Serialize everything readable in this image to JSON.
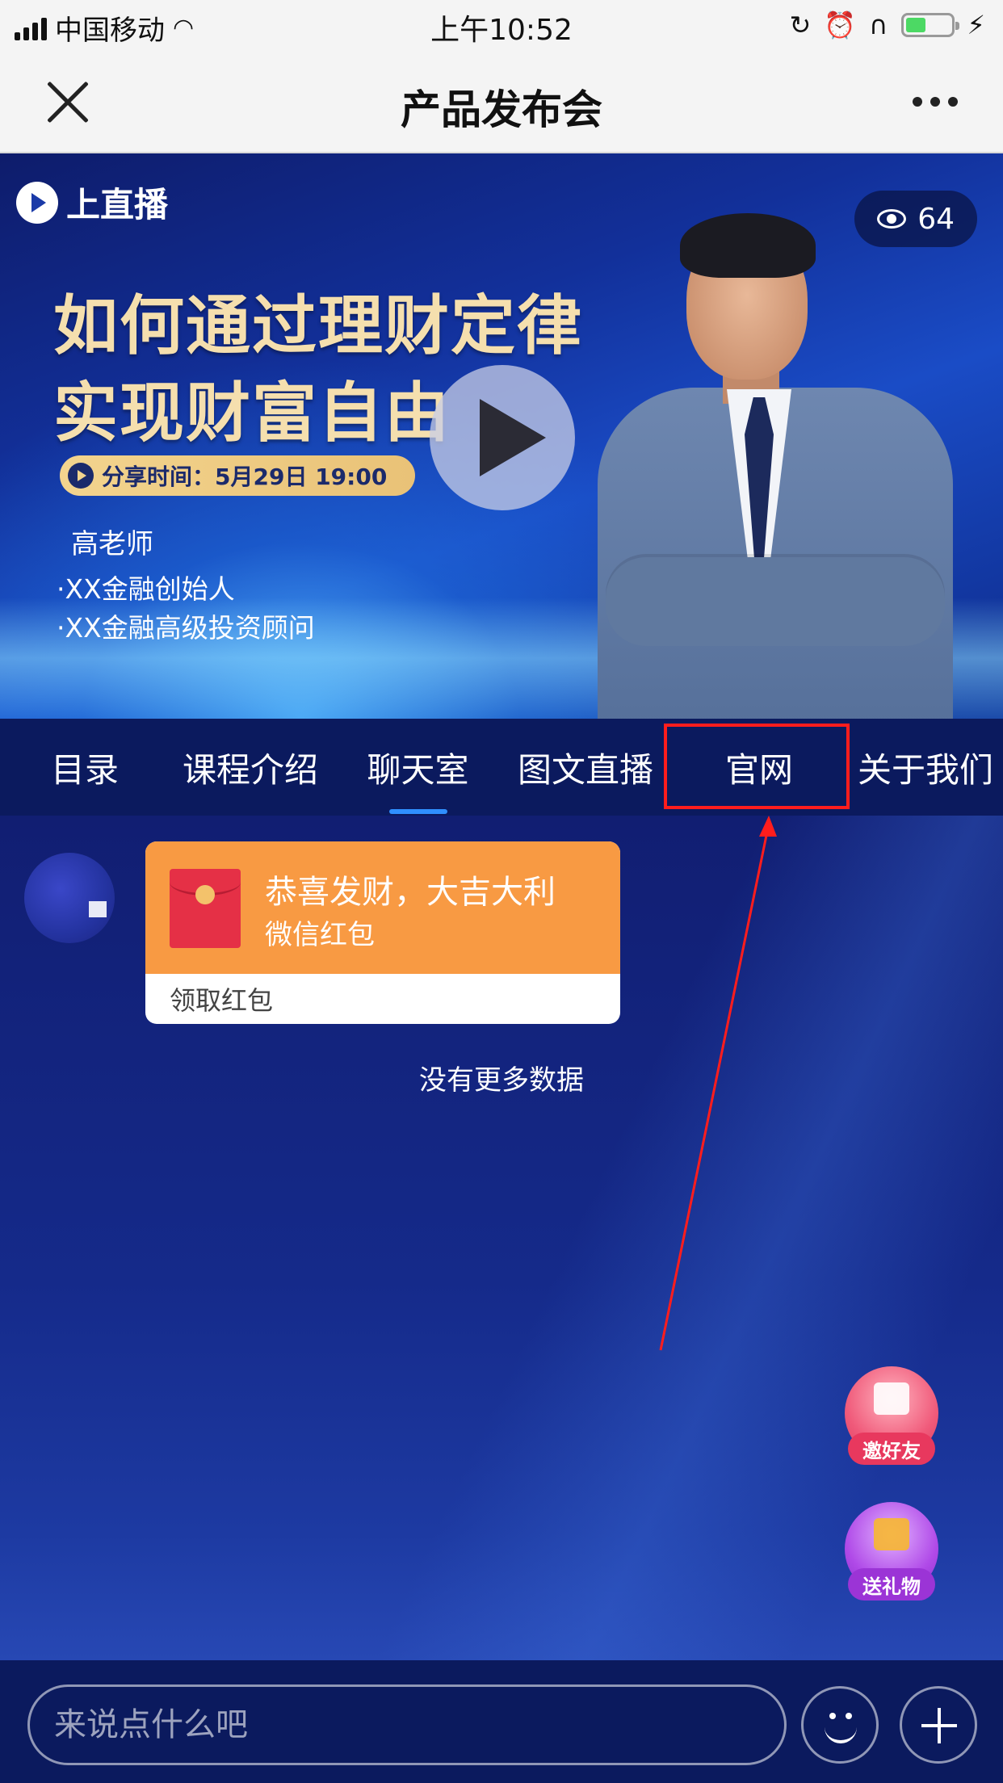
{
  "status_bar": {
    "carrier": "中国移动",
    "time": "上午10:52"
  },
  "nav": {
    "title": "产品发布会"
  },
  "video": {
    "logo_text": "上直播",
    "viewer_count": "64",
    "headline_line1": "如何通过理财定律",
    "headline_line2": "实现财富自由",
    "share_time": "分享时间：5月29日 19:00",
    "teacher_name": "高老师",
    "teacher_title1": "·XX金融创始人",
    "teacher_title2": "·XX金融高级投资顾问"
  },
  "tabs": [
    {
      "label": "目录"
    },
    {
      "label": "课程介绍"
    },
    {
      "label": "聊天室",
      "active": true
    },
    {
      "label": "图文直播"
    },
    {
      "label": "官网",
      "highlighted": true
    },
    {
      "label": "关于我们"
    }
  ],
  "chat": {
    "red_packet": {
      "title": "恭喜发财，大吉大利",
      "subtitle": "微信红包",
      "action": "领取红包"
    },
    "no_more": "没有更多数据"
  },
  "floating": {
    "invite_label": "邀好友",
    "gift_label": "送礼物"
  },
  "input": {
    "placeholder": "来说点什么吧"
  },
  "colors": {
    "accent_blue": "#2f8fff",
    "highlight_red": "#ff1d1d",
    "red_packet_orange": "#f89a43",
    "tab_bg": "#0b1a5e"
  }
}
